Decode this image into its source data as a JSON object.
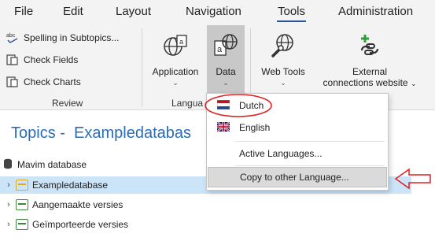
{
  "menubar": {
    "items": [
      "File",
      "Edit",
      "Layout",
      "Navigation",
      "Tools",
      "Administration"
    ],
    "active": "Tools"
  },
  "ribbon": {
    "review": {
      "items": [
        {
          "label": "Spelling in Subtopics...",
          "icon": "spelling-icon"
        },
        {
          "label": "Check Fields",
          "icon": "check-fields-icon"
        },
        {
          "label": "Check Charts",
          "icon": "check-charts-icon"
        }
      ],
      "group_label": "Review"
    },
    "language_group_label": "Langua",
    "buttons": {
      "application": "Application",
      "data": "Data",
      "web_tools": "Web Tools",
      "external_line1": "External",
      "external_line2": "connections website"
    }
  },
  "dropdown": {
    "items": [
      "Dutch",
      "English",
      "Active Languages...",
      "Copy to other Language..."
    ]
  },
  "topics": {
    "title": "Topics -  Exampledatabas"
  },
  "tree": {
    "root": "Mavim database",
    "items": [
      "Exampledatabase",
      "Aangemaakte versies",
      "Geïmporteerde versies"
    ]
  },
  "colors": {
    "accent": "#2b579a",
    "title_blue": "#2b6cb6",
    "selection": "#cce4f7",
    "annotation_red": "#e02020",
    "folder_orange": "#e6a817",
    "folder_green": "#3a8a3a"
  }
}
